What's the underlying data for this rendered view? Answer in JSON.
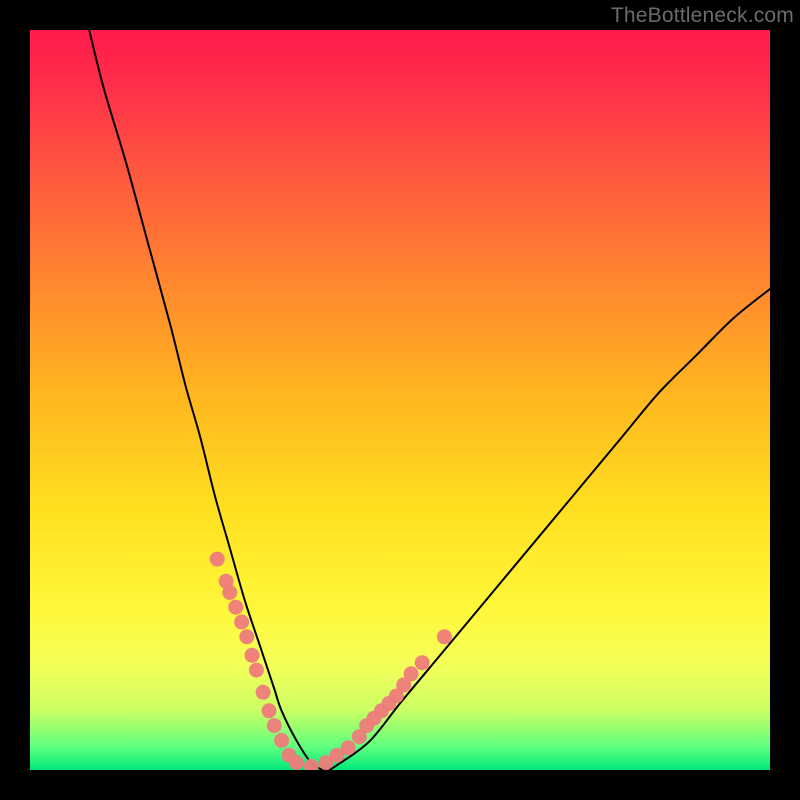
{
  "watermark": "TheBottleneck.com",
  "chart_data": {
    "type": "line",
    "title": "",
    "xlabel": "",
    "ylabel": "",
    "xlim": [
      0,
      100
    ],
    "ylim": [
      0,
      100
    ],
    "grid": false,
    "legend": false,
    "series": [
      {
        "name": "bottleneck-curve",
        "color": "#000000",
        "x": [
          8,
          10,
          13,
          16,
          19,
          21,
          23,
          25,
          27,
          29,
          31,
          33,
          34,
          36,
          38,
          40,
          42,
          46,
          50,
          55,
          60,
          65,
          70,
          75,
          80,
          85,
          90,
          95,
          100
        ],
        "y": [
          100,
          92,
          82,
          71,
          60,
          52,
          45,
          37,
          30,
          23,
          17,
          11,
          8,
          4,
          1,
          0,
          1,
          4,
          9,
          15,
          21,
          27,
          33,
          39,
          45,
          51,
          56,
          61,
          65
        ]
      },
      {
        "name": "highlight-markers-left",
        "type": "scatter",
        "color": "#ee7c7b",
        "x": [
          25.3,
          26.5,
          27.0,
          27.8,
          28.6,
          29.3,
          30.0,
          30.6,
          31.5,
          32.3,
          33.0,
          34.0,
          35.0,
          36.0
        ],
        "y": [
          28.5,
          25.5,
          24.0,
          22.0,
          20.0,
          18.0,
          15.5,
          13.5,
          10.5,
          8.0,
          6.0,
          4.0,
          2.0,
          1.0
        ]
      },
      {
        "name": "highlight-markers-right",
        "type": "scatter",
        "color": "#ee7c7b",
        "x": [
          38.0,
          40.0,
          41.5,
          43.0,
          44.5,
          45.5,
          46.5,
          47.5,
          48.5,
          49.5,
          50.5,
          51.5,
          53.0,
          56.0
        ],
        "y": [
          0.5,
          1.0,
          2.0,
          3.0,
          4.5,
          6.0,
          7.0,
          8.0,
          9.0,
          10.0,
          11.5,
          13.0,
          14.5,
          18.0
        ]
      }
    ],
    "annotations": []
  }
}
